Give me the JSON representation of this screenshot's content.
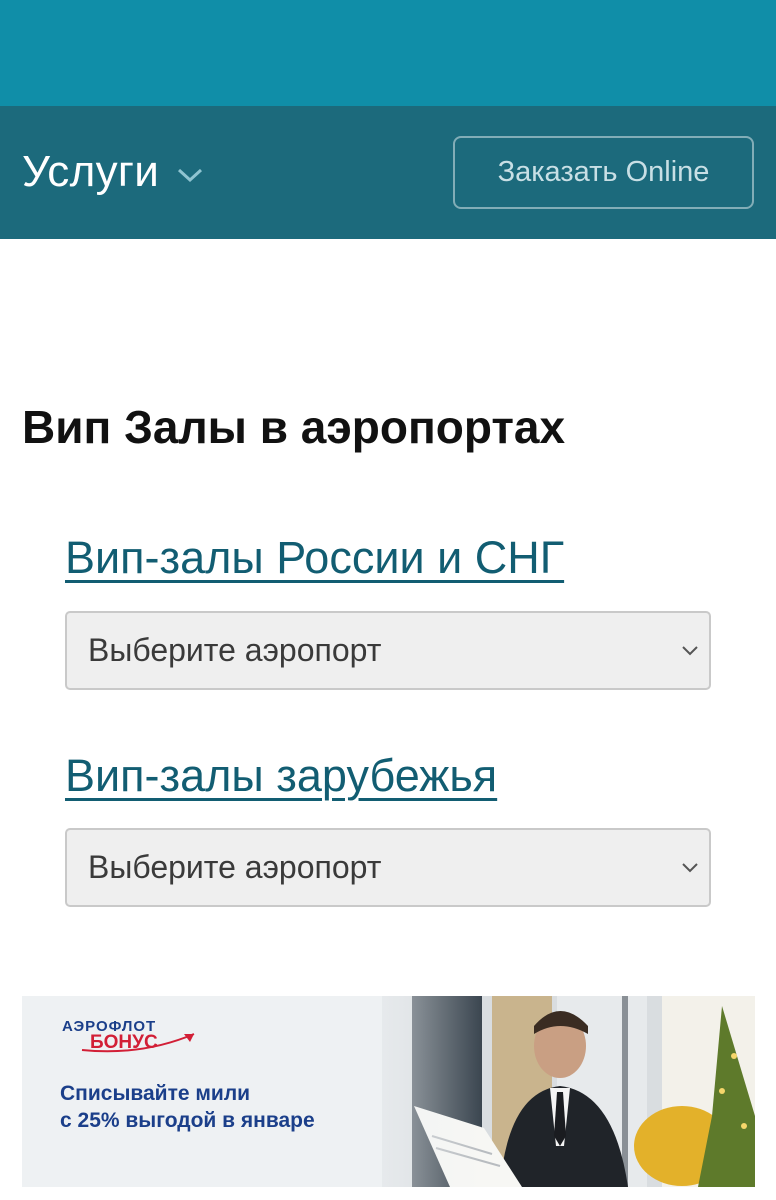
{
  "header": {
    "services_label": "Услуги",
    "order_button_label": "Заказать Online",
    "colors": {
      "top_band": "#108ea8",
      "nav_bar": "#1c6a7c"
    }
  },
  "main": {
    "title": "Вип Залы в аэропортах",
    "sections": [
      {
        "link_label": "Вип-залы России и СНГ",
        "select_value": "Выберите аэропорт"
      },
      {
        "link_label": "Вип-залы зарубежья",
        "select_value": "Выберите аэропорт"
      }
    ]
  },
  "banner": {
    "brand_name": "АЭРОФЛОТ",
    "brand_sub": "БОНУС",
    "line1": "Списывайте мили",
    "line2": "с 25% выгодой в январе"
  }
}
